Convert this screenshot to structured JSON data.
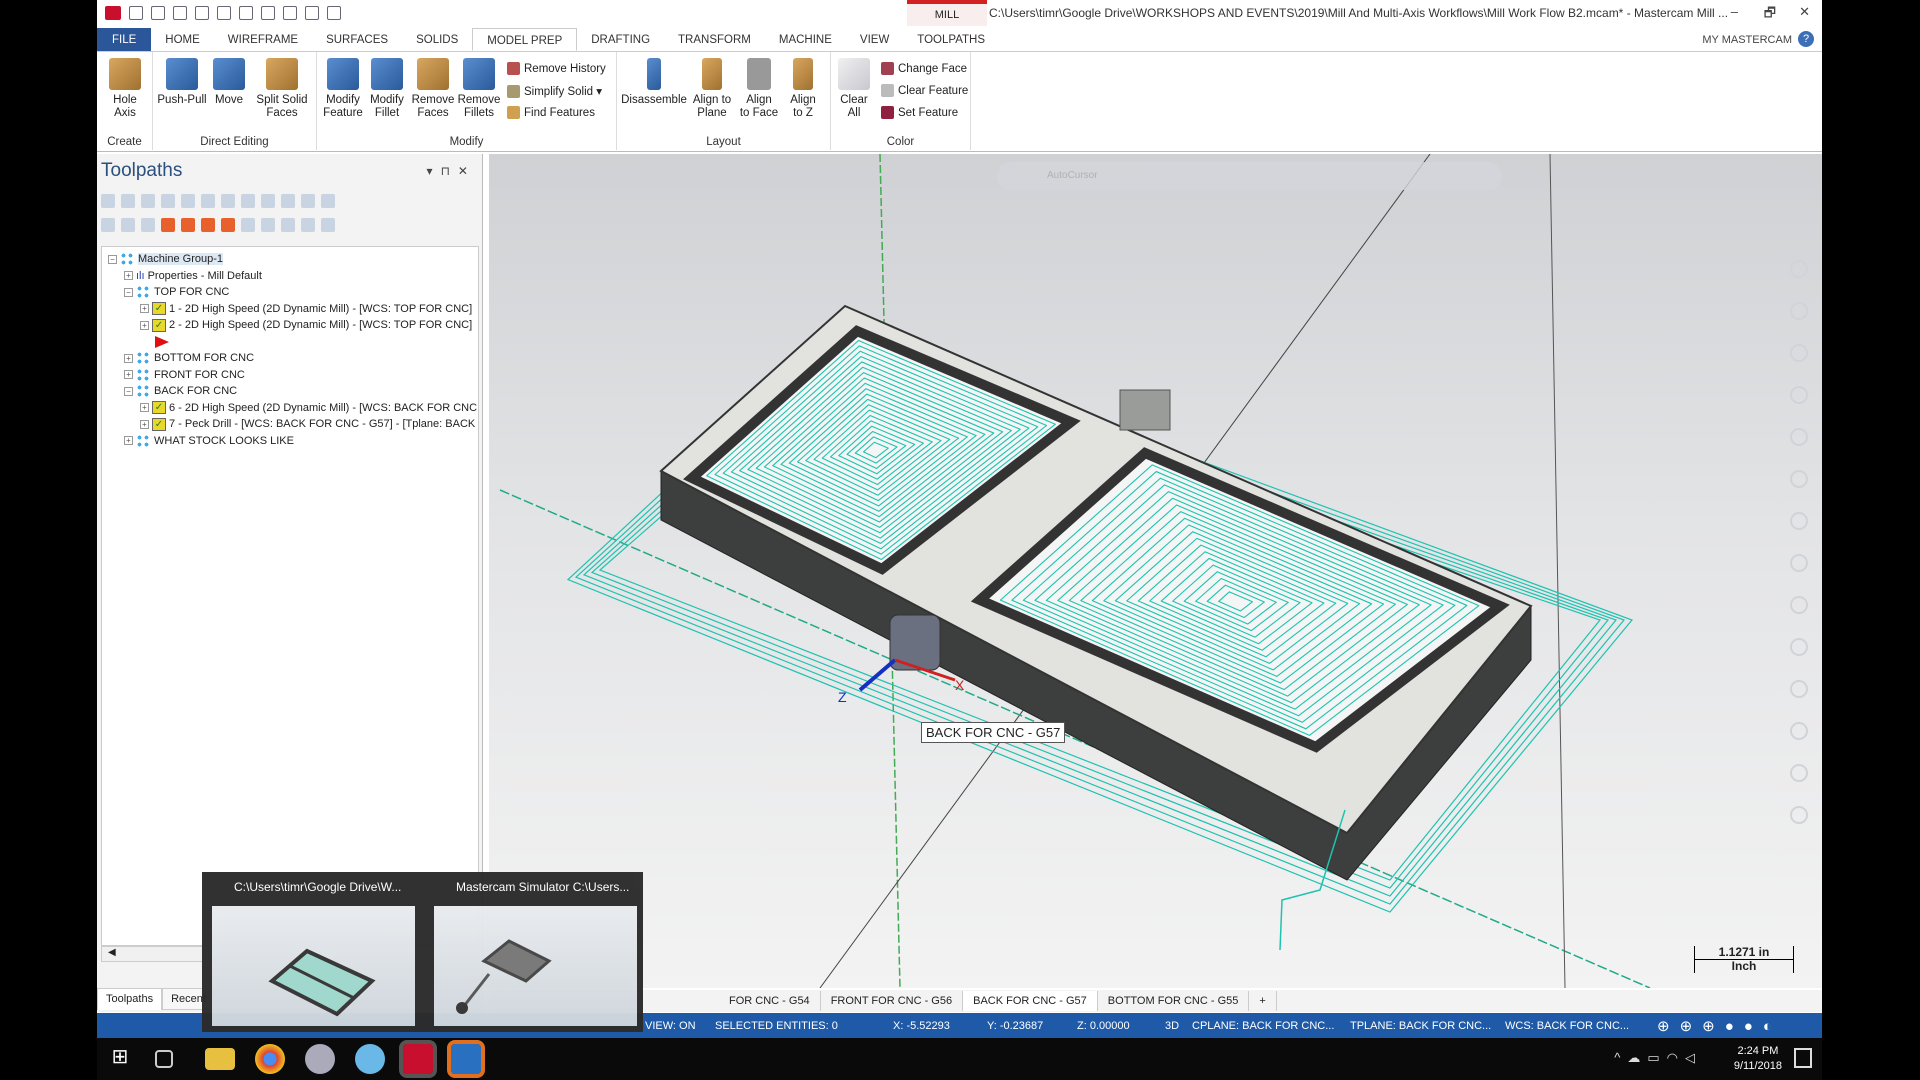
{
  "titlebar": {
    "mill_tab": "MILL",
    "title": "C:\\Users\\timr\\Google Drive\\WORKSHOPS AND EVENTS\\2019\\Mill And Multi-Axis Workflows\\Mill Work Flow B2.mcam* - Mastercam Mill ...",
    "minimize": "–",
    "restore": "🗗",
    "close": "✕"
  },
  "tabs": [
    "FILE",
    "HOME",
    "WIREFRAME",
    "SURFACES",
    "SOLIDS",
    "MODEL PREP",
    "DRAFTING",
    "TRANSFORM",
    "MACHINE",
    "VIEW",
    "TOOLPATHS"
  ],
  "active_tab": "MODEL PREP",
  "my_mastercam": "MY MASTERCAM",
  "ribbon": {
    "create": {
      "label": "Create",
      "buttons": [
        "Hole\nAxis"
      ]
    },
    "direct_editing": {
      "label": "Direct Editing",
      "buttons": [
        "Push-Pull",
        "Move",
        "Split Solid\nFaces"
      ]
    },
    "modify": {
      "label": "Modify",
      "buttons": [
        "Modify\nFeature",
        "Modify\nFillet",
        "Remove\nFaces",
        "Remove\nFillets"
      ],
      "small": [
        "Remove History",
        "Simplify Solid ▾",
        "Find Features"
      ]
    },
    "layout": {
      "label": "Layout",
      "buttons": [
        "Disassemble",
        "Align to\nPlane",
        "Align\nto Face",
        "Align\nto Z"
      ]
    },
    "color": {
      "label": "Color",
      "buttons": [
        "Clear\nAll"
      ],
      "small": [
        "Change Face",
        "Clear Feature",
        "Set Feature"
      ]
    }
  },
  "toolpaths_panel": {
    "title": "Toolpaths",
    "tree": [
      {
        "label": "Machine Group-1",
        "level": 0,
        "type": "group",
        "expanded": true
      },
      {
        "label": "Properties - Mill Default",
        "level": 1,
        "type": "props"
      },
      {
        "label": "TOP FOR CNC",
        "level": 1,
        "type": "group",
        "expanded": true
      },
      {
        "label": "1 - 2D High Speed (2D Dynamic Mill) - [WCS: TOP FOR CNC]",
        "level": 2,
        "type": "op"
      },
      {
        "label": "2 - 2D High Speed (2D Dynamic Mill) - [WCS: TOP FOR CNC]",
        "level": 2,
        "type": "op"
      },
      {
        "label": "",
        "level": 2,
        "type": "insert-arrow"
      },
      {
        "label": "BOTTOM FOR CNC",
        "level": 1,
        "type": "group"
      },
      {
        "label": "FRONT FOR CNC",
        "level": 1,
        "type": "group"
      },
      {
        "label": "BACK FOR CNC",
        "level": 1,
        "type": "group",
        "expanded": true
      },
      {
        "label": "6 - 2D High Speed (2D Dynamic Mill) - [WCS: BACK FOR CNC",
        "level": 2,
        "type": "op"
      },
      {
        "label": "7 - Peck Drill - [WCS: BACK FOR CNC - G57] - [Tplane: BACK",
        "level": 2,
        "type": "op"
      },
      {
        "label": "WHAT STOCK LOOKS LIKE",
        "level": 1,
        "type": "group"
      }
    ],
    "bottom_tabs": [
      "Toolpaths",
      "Recent"
    ]
  },
  "viewport": {
    "toolbar_hint": "AutoCursor",
    "tooltip": "BACK FOR CNC - G57",
    "scale_value": "1.1271 in",
    "scale_unit": "Inch",
    "axis_x": "X",
    "axis_z": "Z",
    "toolpath_color": "#1fc2b0"
  },
  "doc_tabs": [
    "FOR CNC - G54",
    "FRONT FOR CNC - G56",
    "BACK FOR CNC - G57",
    "BOTTOM FOR CNC - G55",
    "+"
  ],
  "active_doc_tab": "BACK FOR CNC - G57",
  "status": {
    "view": "VIEW: ON",
    "selected": "SELECTED ENTITIES: 0",
    "x": "X:  -5.52293",
    "y": "Y:  -0.23687",
    "z": "Z:  0.00000",
    "mode": "3D",
    "cplane": "CPLANE: BACK FOR CNC...",
    "tplane": "TPLANE: BACK FOR CNC...",
    "wcs": "WCS: BACK FOR CNC..."
  },
  "thumbnails": [
    {
      "title": "C:\\Users\\timr\\Google Drive\\W..."
    },
    {
      "title": "Mastercam Simulator  C:\\Users..."
    }
  ],
  "taskbar": {
    "time": "2:24 PM",
    "date": "9/11/2018"
  }
}
